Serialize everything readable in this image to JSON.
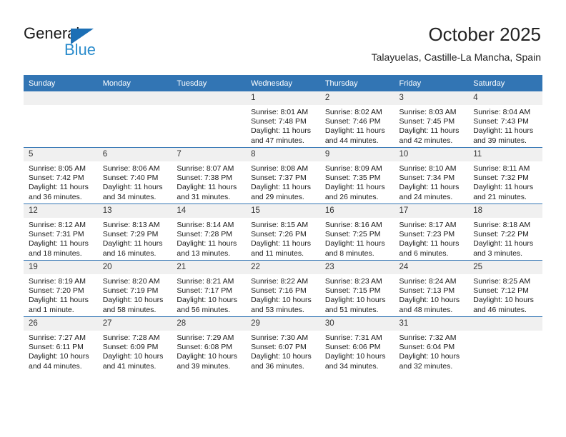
{
  "brand": {
    "name_top": "General",
    "name_bottom": "Blue",
    "triangle_color": "#1c6fb5",
    "blue_text_color": "#2b8ccc"
  },
  "header": {
    "title": "October 2025",
    "subtitle": "Talayuelas, Castille-La Mancha, Spain"
  },
  "theme": {
    "header_blue": "#3275b4",
    "daynum_band": "#f0f0f0",
    "text": "#1a1a1a"
  },
  "weekday_headers": [
    "Sunday",
    "Monday",
    "Tuesday",
    "Wednesday",
    "Thursday",
    "Friday",
    "Saturday"
  ],
  "weeks": [
    [
      {
        "day": "",
        "empty": true,
        "lines": []
      },
      {
        "day": "",
        "empty": true,
        "lines": []
      },
      {
        "day": "",
        "empty": true,
        "lines": []
      },
      {
        "day": "1",
        "empty": false,
        "lines": [
          "Sunrise: 8:01 AM",
          "Sunset: 7:48 PM",
          "Daylight: 11 hours",
          "and 47 minutes."
        ]
      },
      {
        "day": "2",
        "empty": false,
        "lines": [
          "Sunrise: 8:02 AM",
          "Sunset: 7:46 PM",
          "Daylight: 11 hours",
          "and 44 minutes."
        ]
      },
      {
        "day": "3",
        "empty": false,
        "lines": [
          "Sunrise: 8:03 AM",
          "Sunset: 7:45 PM",
          "Daylight: 11 hours",
          "and 42 minutes."
        ]
      },
      {
        "day": "4",
        "empty": false,
        "lines": [
          "Sunrise: 8:04 AM",
          "Sunset: 7:43 PM",
          "Daylight: 11 hours",
          "and 39 minutes."
        ]
      }
    ],
    [
      {
        "day": "5",
        "empty": false,
        "lines": [
          "Sunrise: 8:05 AM",
          "Sunset: 7:42 PM",
          "Daylight: 11 hours",
          "and 36 minutes."
        ]
      },
      {
        "day": "6",
        "empty": false,
        "lines": [
          "Sunrise: 8:06 AM",
          "Sunset: 7:40 PM",
          "Daylight: 11 hours",
          "and 34 minutes."
        ]
      },
      {
        "day": "7",
        "empty": false,
        "lines": [
          "Sunrise: 8:07 AM",
          "Sunset: 7:38 PM",
          "Daylight: 11 hours",
          "and 31 minutes."
        ]
      },
      {
        "day": "8",
        "empty": false,
        "lines": [
          "Sunrise: 8:08 AM",
          "Sunset: 7:37 PM",
          "Daylight: 11 hours",
          "and 29 minutes."
        ]
      },
      {
        "day": "9",
        "empty": false,
        "lines": [
          "Sunrise: 8:09 AM",
          "Sunset: 7:35 PM",
          "Daylight: 11 hours",
          "and 26 minutes."
        ]
      },
      {
        "day": "10",
        "empty": false,
        "lines": [
          "Sunrise: 8:10 AM",
          "Sunset: 7:34 PM",
          "Daylight: 11 hours",
          "and 24 minutes."
        ]
      },
      {
        "day": "11",
        "empty": false,
        "lines": [
          "Sunrise: 8:11 AM",
          "Sunset: 7:32 PM",
          "Daylight: 11 hours",
          "and 21 minutes."
        ]
      }
    ],
    [
      {
        "day": "12",
        "empty": false,
        "lines": [
          "Sunrise: 8:12 AM",
          "Sunset: 7:31 PM",
          "Daylight: 11 hours",
          "and 18 minutes."
        ]
      },
      {
        "day": "13",
        "empty": false,
        "lines": [
          "Sunrise: 8:13 AM",
          "Sunset: 7:29 PM",
          "Daylight: 11 hours",
          "and 16 minutes."
        ]
      },
      {
        "day": "14",
        "empty": false,
        "lines": [
          "Sunrise: 8:14 AM",
          "Sunset: 7:28 PM",
          "Daylight: 11 hours",
          "and 13 minutes."
        ]
      },
      {
        "day": "15",
        "empty": false,
        "lines": [
          "Sunrise: 8:15 AM",
          "Sunset: 7:26 PM",
          "Daylight: 11 hours",
          "and 11 minutes."
        ]
      },
      {
        "day": "16",
        "empty": false,
        "lines": [
          "Sunrise: 8:16 AM",
          "Sunset: 7:25 PM",
          "Daylight: 11 hours",
          "and 8 minutes."
        ]
      },
      {
        "day": "17",
        "empty": false,
        "lines": [
          "Sunrise: 8:17 AM",
          "Sunset: 7:23 PM",
          "Daylight: 11 hours",
          "and 6 minutes."
        ]
      },
      {
        "day": "18",
        "empty": false,
        "lines": [
          "Sunrise: 8:18 AM",
          "Sunset: 7:22 PM",
          "Daylight: 11 hours",
          "and 3 minutes."
        ]
      }
    ],
    [
      {
        "day": "19",
        "empty": false,
        "lines": [
          "Sunrise: 8:19 AM",
          "Sunset: 7:20 PM",
          "Daylight: 11 hours",
          "and 1 minute."
        ]
      },
      {
        "day": "20",
        "empty": false,
        "lines": [
          "Sunrise: 8:20 AM",
          "Sunset: 7:19 PM",
          "Daylight: 10 hours",
          "and 58 minutes."
        ]
      },
      {
        "day": "21",
        "empty": false,
        "lines": [
          "Sunrise: 8:21 AM",
          "Sunset: 7:17 PM",
          "Daylight: 10 hours",
          "and 56 minutes."
        ]
      },
      {
        "day": "22",
        "empty": false,
        "lines": [
          "Sunrise: 8:22 AM",
          "Sunset: 7:16 PM",
          "Daylight: 10 hours",
          "and 53 minutes."
        ]
      },
      {
        "day": "23",
        "empty": false,
        "lines": [
          "Sunrise: 8:23 AM",
          "Sunset: 7:15 PM",
          "Daylight: 10 hours",
          "and 51 minutes."
        ]
      },
      {
        "day": "24",
        "empty": false,
        "lines": [
          "Sunrise: 8:24 AM",
          "Sunset: 7:13 PM",
          "Daylight: 10 hours",
          "and 48 minutes."
        ]
      },
      {
        "day": "25",
        "empty": false,
        "lines": [
          "Sunrise: 8:25 AM",
          "Sunset: 7:12 PM",
          "Daylight: 10 hours",
          "and 46 minutes."
        ]
      }
    ],
    [
      {
        "day": "26",
        "empty": false,
        "lines": [
          "Sunrise: 7:27 AM",
          "Sunset: 6:11 PM",
          "Daylight: 10 hours",
          "and 44 minutes."
        ]
      },
      {
        "day": "27",
        "empty": false,
        "lines": [
          "Sunrise: 7:28 AM",
          "Sunset: 6:09 PM",
          "Daylight: 10 hours",
          "and 41 minutes."
        ]
      },
      {
        "day": "28",
        "empty": false,
        "lines": [
          "Sunrise: 7:29 AM",
          "Sunset: 6:08 PM",
          "Daylight: 10 hours",
          "and 39 minutes."
        ]
      },
      {
        "day": "29",
        "empty": false,
        "lines": [
          "Sunrise: 7:30 AM",
          "Sunset: 6:07 PM",
          "Daylight: 10 hours",
          "and 36 minutes."
        ]
      },
      {
        "day": "30",
        "empty": false,
        "lines": [
          "Sunrise: 7:31 AM",
          "Sunset: 6:06 PM",
          "Daylight: 10 hours",
          "and 34 minutes."
        ]
      },
      {
        "day": "31",
        "empty": false,
        "lines": [
          "Sunrise: 7:32 AM",
          "Sunset: 6:04 PM",
          "Daylight: 10 hours",
          "and 32 minutes."
        ]
      },
      {
        "day": "",
        "empty": true,
        "lines": []
      }
    ]
  ]
}
